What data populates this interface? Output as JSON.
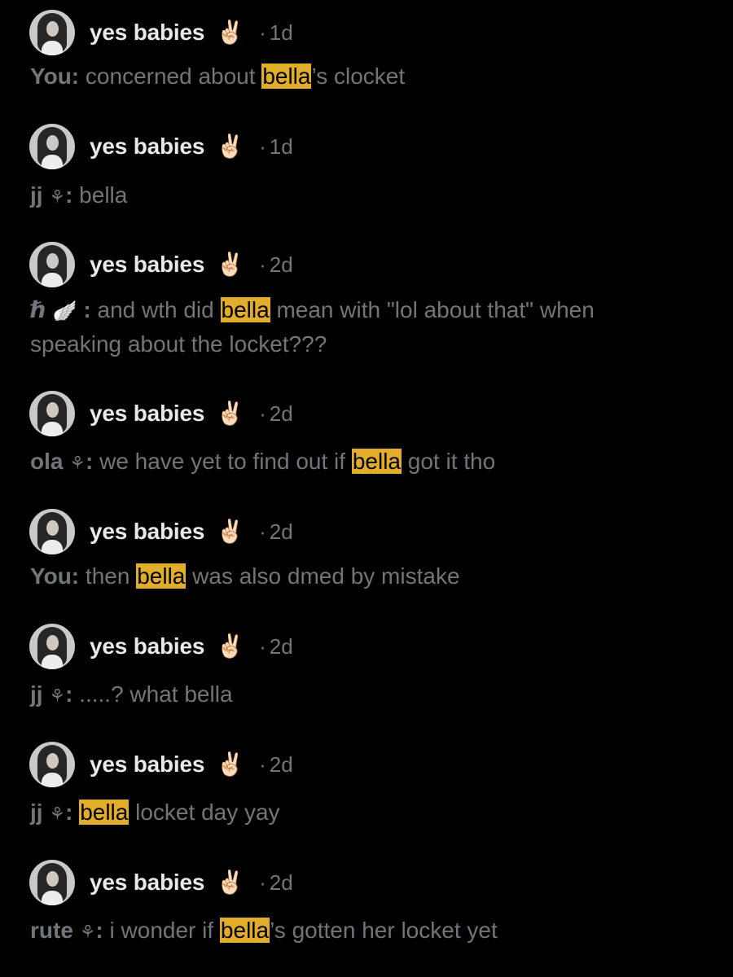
{
  "results": [
    {
      "name": "yes babies",
      "badge": "✌🏻",
      "sep": "·",
      "time": "1d",
      "sender": "You:",
      "sender_icon": "",
      "text_before": " concerned about ",
      "highlight": "bella",
      "text_after": "’s clocket"
    },
    {
      "name": "yes babies",
      "badge": "✌🏻",
      "sep": "·",
      "time": "1d",
      "sender": "jj",
      "sender_icon": "⚘",
      "sender_colon": ":",
      "text_before": " bella",
      "highlight": "",
      "text_after": ""
    },
    {
      "name": "yes babies",
      "badge": "✌🏻",
      "sep": "·",
      "time": "2d",
      "sender": "ℏ",
      "sender_icon": "🪽",
      "sender_colon": " :",
      "text_before": " and wth did ",
      "highlight": "bella",
      "text_after": " mean with \"lol about that\" when speaking about the locket???"
    },
    {
      "name": "yes babies",
      "badge": "✌🏻",
      "sep": "·",
      "time": "2d",
      "sender": "ola",
      "sender_icon": "⚘",
      "sender_colon": ":",
      "text_before": " we have yet to find out if ",
      "highlight": "bella",
      "text_after": " got it tho"
    },
    {
      "name": "yes babies",
      "badge": "✌🏻",
      "sep": "·",
      "time": "2d",
      "sender": "You:",
      "sender_icon": "",
      "text_before": " then ",
      "highlight": "bella",
      "text_after": " was also dmed by mistake"
    },
    {
      "name": "yes babies",
      "badge": "✌🏻",
      "sep": "·",
      "time": "2d",
      "sender": "jj",
      "sender_icon": "⚘",
      "sender_colon": ":",
      "text_before": " .....? what bella",
      "highlight": "",
      "text_after": ""
    },
    {
      "name": "yes babies",
      "badge": "✌🏻",
      "sep": "·",
      "time": "2d",
      "sender": "jj",
      "sender_icon": "⚘",
      "sender_colon": ":",
      "text_before": " ",
      "highlight": "bella",
      "text_after": " locket day yay"
    },
    {
      "name": "yes babies",
      "badge": "✌🏻",
      "sep": "·",
      "time": "2d",
      "sender": "rute",
      "sender_icon": "⚘",
      "sender_colon": ":",
      "text_before": " i wonder if ",
      "highlight": "bella",
      "text_after": "’s gotten her locket yet"
    }
  ],
  "colors": {
    "background": "#000000",
    "name": "#e7e9ea",
    "secondary": "#71767b",
    "highlight": "#e2ad2a"
  }
}
